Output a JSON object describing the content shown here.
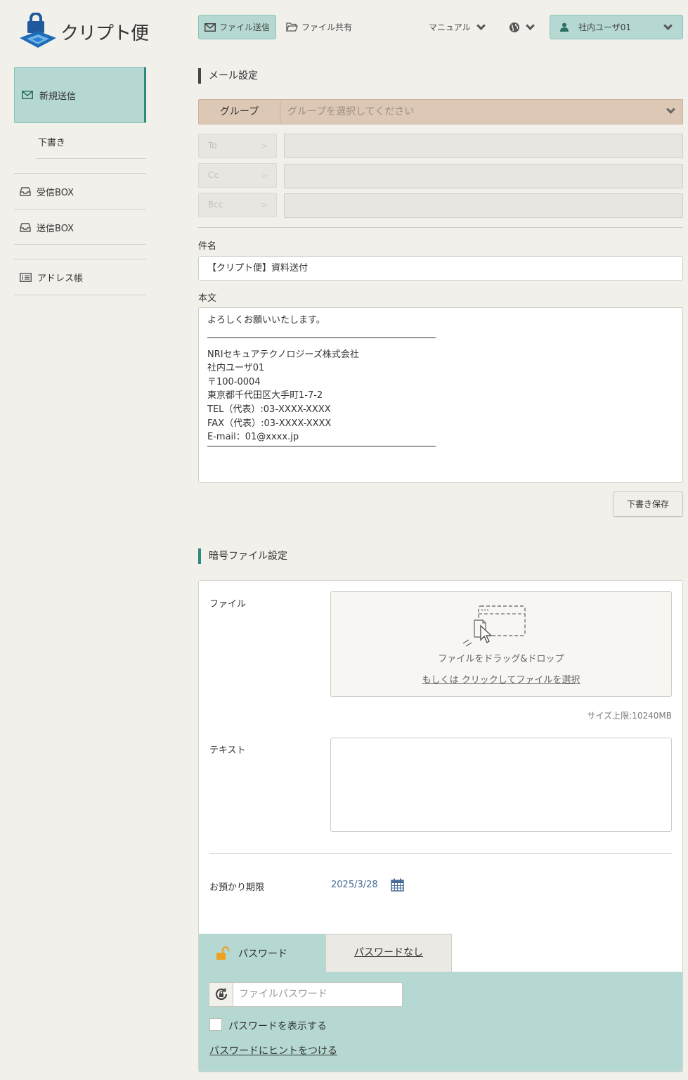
{
  "app": {
    "logo_text": "クリプト便"
  },
  "header": {
    "file_send": "ファイル送信",
    "file_share": "ファイル共有",
    "manual": "マニュアル",
    "user": "社内ユーザ01"
  },
  "sidebar": {
    "new_send": "新規送信",
    "draft": "下書き",
    "inbox": "受信BOX",
    "outbox": "送信BOX",
    "address_book": "アドレス帳"
  },
  "mail_settings": {
    "title": "メール設定",
    "group_label": "グループ",
    "group_placeholder": "グループを選択してください",
    "to_label": "To",
    "cc_label": "Cc",
    "bcc_label": "Bcc",
    "subject_label": "件名",
    "subject_value": "【クリプト便】資料送付",
    "body_label": "本文",
    "body_greeting": "よろしくお願いいたします。",
    "signature": [
      "NRIセキュアテクノロジーズ株式会社",
      "社内ユーザ01",
      "〒100-0004",
      "東京都千代田区大手町1-7-2",
      "TEL（代表）:03-XXXX-XXXX",
      "FAX（代表）:03-XXXX-XXXX",
      "E-mail：01@xxxx.jp"
    ],
    "save_draft": "下書き保存"
  },
  "file_settings": {
    "title": "暗号ファイル設定",
    "file_label": "ファイル",
    "drop_text": "ファイルをドラッグ&ドロップ",
    "drop_link": "もしくは クリックしてファイルを選択",
    "size_limit": "サイズ上限:10240MB",
    "text_label": "テキスト",
    "retention_label": "お預かり期限",
    "retention_date": "2025/3/28"
  },
  "password": {
    "tab_password": "パスワード",
    "tab_no_password": "パスワードなし",
    "input_placeholder": "ファイルパスワード",
    "show_password": "パスワードを表示する",
    "add_hint": "パスワードにヒントをつける"
  },
  "colors": {
    "accent_teal": "#b5d9d2",
    "accent_dark_teal": "#2d8a7a",
    "group_bg": "#ddc8b6",
    "lock_orange": "#f0a020",
    "logo_blue": "#1e6bb8"
  }
}
